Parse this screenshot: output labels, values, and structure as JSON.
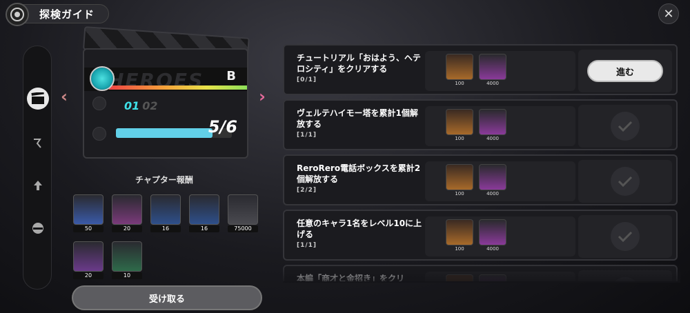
{
  "header": {
    "title": "探検ガイド",
    "close_glyph": "✕"
  },
  "rail": {
    "items": [
      {
        "name": "clapperboard-icon",
        "active": true
      },
      {
        "name": "runner-icon",
        "active": false
      },
      {
        "name": "arrow-up-icon",
        "active": false
      },
      {
        "name": "badge-icon",
        "active": false
      }
    ]
  },
  "chapter": {
    "grade": "B",
    "watermark": "HEROES",
    "current": "01",
    "next": "02",
    "progress_text": "5/6",
    "progress_ratio": 0.833,
    "prev_glyph": "‹",
    "next_glyph": "›"
  },
  "chapter_rewards": {
    "title": "チャプター報酬",
    "items": [
      {
        "qty": "50",
        "icon": "polychrome-icon",
        "color": "#3a5aa8"
      },
      {
        "qty": "20",
        "icon": "tape-icon",
        "color": "#7a3a7a"
      },
      {
        "qty": "16",
        "icon": "document-icon",
        "color": "#2e4f8a"
      },
      {
        "qty": "16",
        "icon": "crystal-icon",
        "color": "#2e4f8a"
      },
      {
        "qty": "75000",
        "icon": "coin-icon",
        "color": "#4a4a50"
      },
      {
        "qty": "20",
        "icon": "bangboo-icon",
        "color": "#6a3a8a"
      },
      {
        "qty": "10",
        "icon": "device-icon",
        "color": "#2e6a4a"
      }
    ],
    "claim_label": "受け取る"
  },
  "missions": [
    {
      "text": "チュートリアル「おはよう、ヘテロシティ」をクリアする",
      "progress": "[0/1]",
      "rewards": [
        "100",
        "4000"
      ],
      "status": "go",
      "action_label": "進む"
    },
    {
      "text": "ヴェルテハイモー塔を累計1個解放する",
      "progress": "[1/1]",
      "rewards": [
        "100",
        "4000"
      ],
      "status": "done"
    },
    {
      "text": "ReroRero電話ボックスを累計2個解放する",
      "progress": "[2/2]",
      "rewards": [
        "100",
        "4000"
      ],
      "status": "done"
    },
    {
      "text": "任意のキャラ1名をレベル10に上げる",
      "progress": "[1/1]",
      "rewards": [
        "100",
        "4000"
      ],
      "status": "done"
    },
    {
      "text": "本編「商才と金招き」をクリ",
      "progress": "",
      "rewards": [
        "",
        ""
      ],
      "status": "done"
    }
  ],
  "colors": {
    "accent_cyan": "#3ee0e8",
    "arrow_pink": "#e46a9a"
  }
}
